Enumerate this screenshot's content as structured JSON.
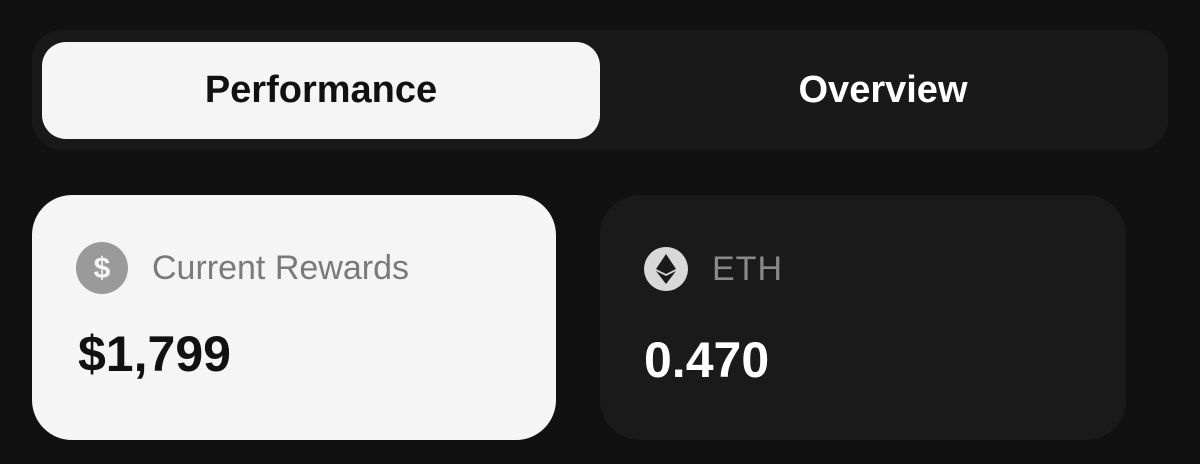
{
  "tabs": {
    "active_label": "Performance",
    "inactive_label": "Overview"
  },
  "cards": [
    {
      "icon": "dollar-coin-icon",
      "label": "Current Rewards",
      "value": "$1,799"
    },
    {
      "icon": "ethereum-icon",
      "label": "ETH",
      "value": "0.470"
    }
  ],
  "colors": {
    "background": "#111111",
    "active_tab": "#f5f5f5",
    "dark_card": "#1a1a1a"
  }
}
